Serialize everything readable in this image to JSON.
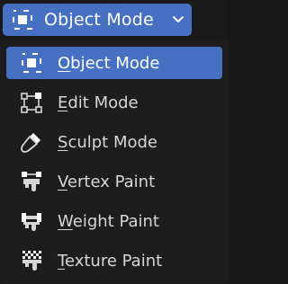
{
  "header": {
    "current_mode": "Object Mode",
    "icon": "object-mode-icon",
    "dropdown_icon": "chevron-down-icon"
  },
  "menu": {
    "items": [
      {
        "first": "O",
        "rest": "bject Mode",
        "icon": "object-mode-icon",
        "active": true
      },
      {
        "first": "E",
        "rest": "dit Mode",
        "icon": "edit-mode-icon",
        "active": false
      },
      {
        "first": "S",
        "rest": "culpt Mode",
        "icon": "sculpt-mode-icon",
        "active": false
      },
      {
        "first": "V",
        "rest": "ertex Paint",
        "icon": "vertex-paint-icon",
        "active": false
      },
      {
        "first": "W",
        "rest": "eight Paint",
        "icon": "weight-paint-icon",
        "active": false
      },
      {
        "first": "T",
        "rest": "exture Paint",
        "icon": "texture-paint-icon",
        "active": false
      }
    ]
  },
  "colors": {
    "accent": "#4671c2",
    "menu_bg": "#1d1d1d",
    "text": "#d6d6d6"
  }
}
